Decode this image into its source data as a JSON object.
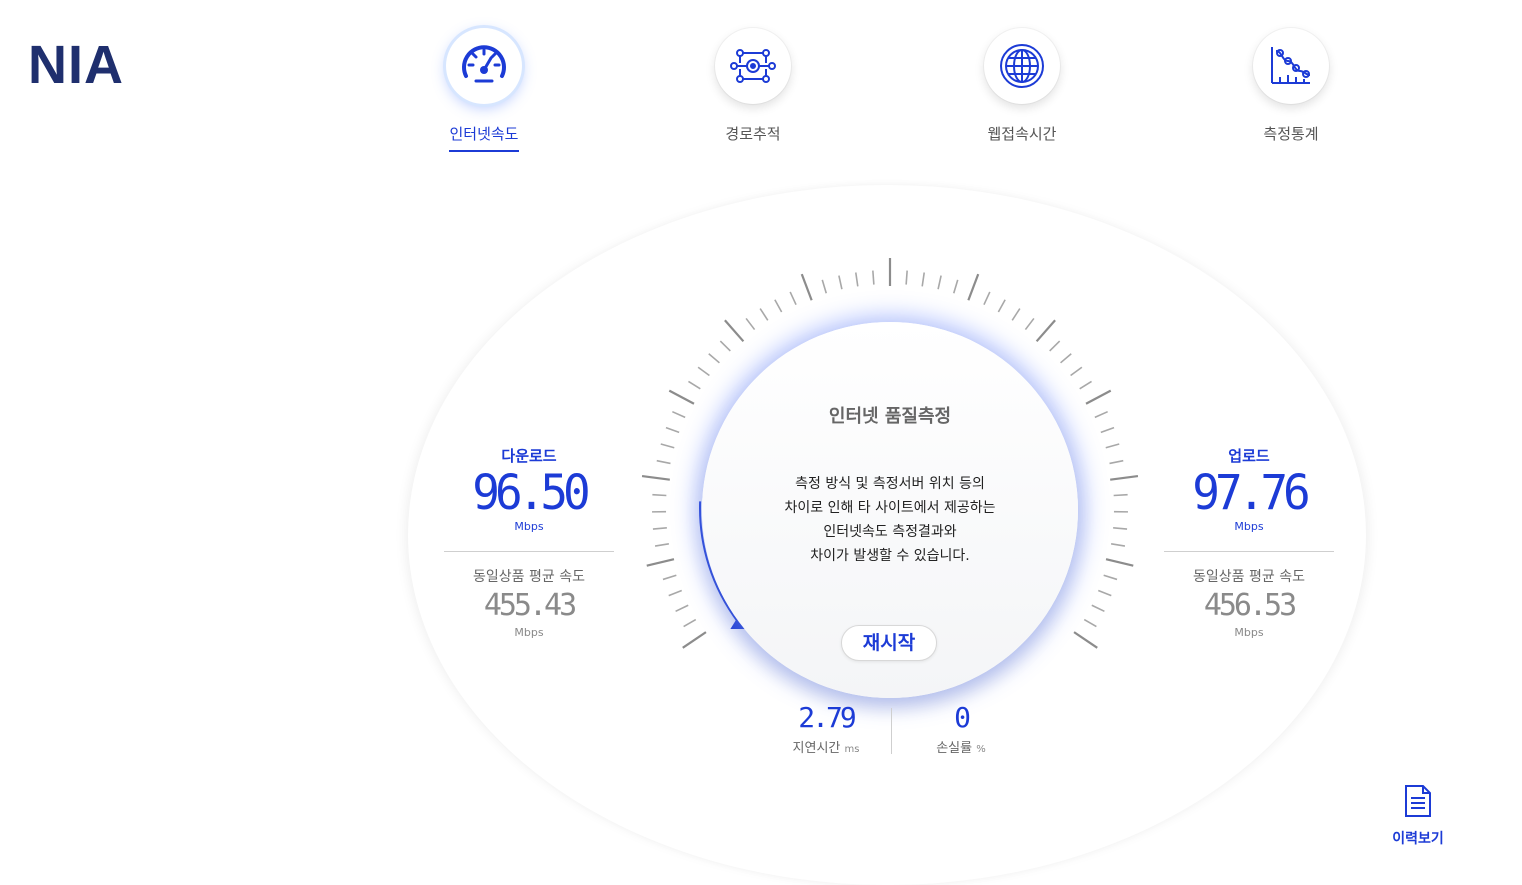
{
  "logo": "NIA",
  "nav": [
    {
      "label": "인터넷속도",
      "icon": "speedometer-icon",
      "active": true
    },
    {
      "label": "경로추적",
      "icon": "route-trace-icon",
      "active": false
    },
    {
      "label": "웹접속시간",
      "icon": "globe-icon",
      "active": false
    },
    {
      "label": "측정통계",
      "icon": "statistics-icon",
      "active": false
    }
  ],
  "gauge": {
    "title": "인터넷 품질측정",
    "message": [
      "측정 방식 및 측정서버 위치 등의",
      "차이로 인해 타 사이트에서 제공하는",
      "인터넷속도 측정결과와",
      "차이가 발생할 수 있습니다."
    ],
    "restart_label": "재시작"
  },
  "download": {
    "label": "다운로드",
    "value": "96.50",
    "unit": "Mbps",
    "avg_label": "동일상품 평균 속도",
    "avg_value": "455.43",
    "avg_unit": "Mbps"
  },
  "upload": {
    "label": "업로드",
    "value": "97.76",
    "unit": "Mbps",
    "avg_label": "동일상품 평균 속도",
    "avg_value": "456.53",
    "avg_unit": "Mbps"
  },
  "latency": {
    "value": "2.79",
    "label": "지연시간",
    "unit": "ms"
  },
  "loss": {
    "value": "0",
    "label": "손실률",
    "unit": "%"
  },
  "history_label": "이력보기",
  "colors": {
    "accent": "#1c3bd6",
    "logo": "#1f2f6e",
    "tick": "#9a9a9a",
    "glow": "#6e8cff"
  }
}
